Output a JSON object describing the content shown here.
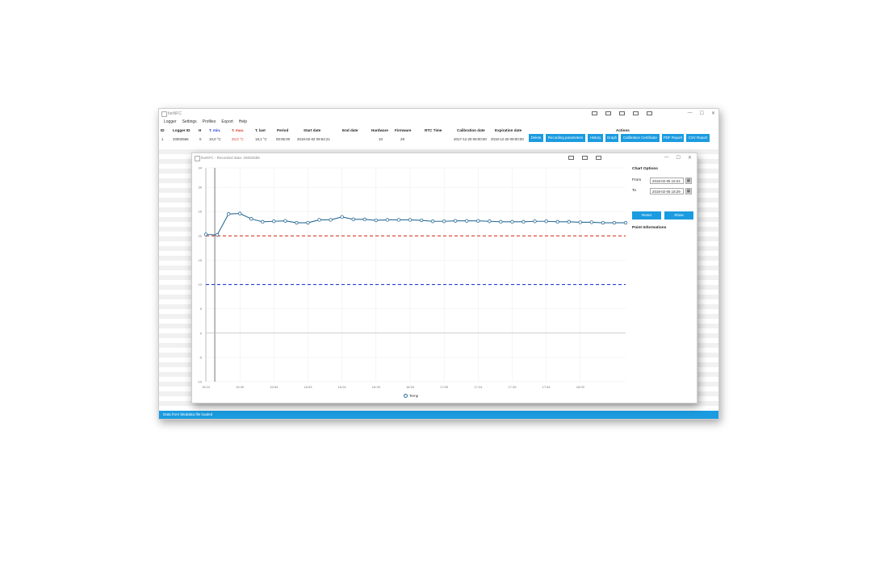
{
  "app": {
    "title": "bioNFC",
    "menu": [
      "Logger",
      "Settings",
      "Profiles",
      "Export",
      "Help"
    ],
    "window_controls": [
      "—",
      "☐",
      "✕"
    ],
    "columns": {
      "id": "ID",
      "logger_id": "Logger ID",
      "h": "H",
      "t_min": "T. min.",
      "t_max": "T. max.",
      "t_last": "T. last",
      "period": "Period",
      "start_date": "Start date",
      "end_date": "End date",
      "hardware": "Hardware",
      "firmware": "Firmware",
      "rtc_time": "RTC Time",
      "calibration_date": "Calibration date",
      "expiration_date": "Expiration date",
      "actions": "Actions"
    },
    "row": {
      "id": "1",
      "logger_id": "20002556",
      "h": "0",
      "t_min": "10,0 °C",
      "t_max": "20,0 °C",
      "t_last": "18,1 °C",
      "period": "00:05:00",
      "start_date": "2018-02-02 09:54:21",
      "end_date": "",
      "hardware": "10",
      "firmware": "28",
      "rtc_time": "",
      "calibration_date": "2017-12-20 09:00:00",
      "expiration_date": "2018-12-20 09:00:00"
    },
    "actions": [
      "Delete",
      "Recording parameters",
      "History",
      "Graph",
      "Calibration Certificate",
      "PDF Report",
      "CSV Report"
    ],
    "status": "Data from bloddata file loaded",
    "colors": {
      "accent": "#1b9be0",
      "t_min": "#2a3fd6",
      "t_max": "#d63a2a"
    }
  },
  "chart_window": {
    "title": "bioNFC - Recorded data: 20002556",
    "options_title": "Chart Options",
    "from_label": "From",
    "from_value": "2018-02-05 15:24",
    "to_label": "To",
    "to_value": "2018-02-05 18:29",
    "reset_label": "Reset",
    "show_label": "Show",
    "point_info_title": "Point Informations",
    "calendar_icon": "calendar-icon"
  },
  "chart_data": {
    "type": "line",
    "title": "",
    "xlabel": "",
    "ylabel": "",
    "ylim": [
      -10,
      34
    ],
    "yticks": [
      -10,
      -5,
      0,
      5,
      10,
      15,
      20,
      25,
      30,
      34
    ],
    "x_tick_labels": [
      "15:24",
      "15:39",
      "15:54",
      "16:09",
      "16:24",
      "16:39",
      "16:54",
      "17:09",
      "17:24",
      "17:39",
      "17:54",
      "18:09"
    ],
    "grid": true,
    "legend": "bottom",
    "series": [
      {
        "name": "Temp",
        "color": "#2b6c96",
        "x": [
          "15:24",
          "15:29",
          "15:34",
          "15:39",
          "15:44",
          "15:49",
          "15:54",
          "15:59",
          "16:04",
          "16:09",
          "16:14",
          "16:19",
          "16:24",
          "16:29",
          "16:34",
          "16:39",
          "16:44",
          "16:49",
          "16:54",
          "16:59",
          "17:04",
          "17:09",
          "17:14",
          "17:19",
          "17:24",
          "17:29",
          "17:34",
          "17:39",
          "17:44",
          "17:49",
          "17:54",
          "17:59",
          "18:04",
          "18:09",
          "18:14",
          "18:19",
          "18:24",
          "18:29"
        ],
        "values": [
          20.3,
          20.2,
          24.5,
          24.6,
          23.5,
          22.9,
          23.0,
          23.1,
          22.7,
          22.7,
          23.3,
          23.3,
          23.9,
          23.4,
          23.4,
          23.2,
          23.3,
          23.3,
          23.3,
          23.2,
          23.0,
          23.0,
          23.1,
          23.1,
          23.1,
          23.0,
          22.9,
          22.9,
          22.9,
          23.0,
          23.0,
          22.9,
          22.9,
          22.8,
          22.8,
          22.7,
          22.7,
          22.7
        ]
      }
    ],
    "reference_lines": [
      {
        "value": 20,
        "color": "#d63a2a",
        "style": "dashed"
      },
      {
        "value": 10,
        "color": "#2a3fd6",
        "style": "dashed"
      },
      {
        "value": 0,
        "color": "#bdbdbd",
        "style": "solid"
      }
    ]
  }
}
